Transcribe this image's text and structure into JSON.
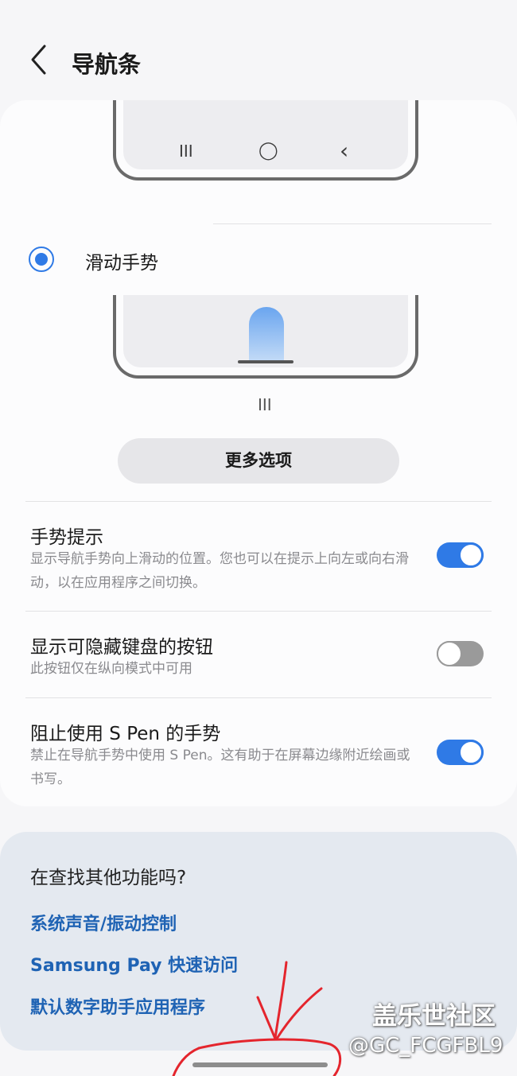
{
  "header": {
    "title": "导航条",
    "back_icon": "chevron-left-icon"
  },
  "preview_buttons": {
    "icons": [
      "recents-icon",
      "home-icon",
      "back-icon"
    ],
    "recents": "III",
    "home": "◯",
    "back": "‹"
  },
  "swipe_option": {
    "label": "滑动手势",
    "selected": true,
    "handle_glyph": "III"
  },
  "more_options_button": "更多选项",
  "settings": [
    {
      "title": "手势提示",
      "description": "显示导航手势向上滑动的位置。您也可以在提示上向左或向右滑动，以在应用程序之间切换。",
      "enabled": true
    },
    {
      "title": "显示可隐藏键盘的按钮",
      "description": "此按钮仅在纵向模式中可用",
      "enabled": false
    },
    {
      "title": "阻止使用 S Pen 的手势",
      "description": "禁止在导航手势中使用 S Pen。这有助于在屏幕边缘附近绘画或书写。",
      "enabled": true
    }
  ],
  "suggestions": {
    "heading": "在查找其他功能吗?",
    "links": [
      "系统声音/振动控制",
      "Samsung Pay 快速访问",
      "默认数字助手应用程序"
    ]
  },
  "watermark": {
    "line1": "盖乐世社区",
    "line2": "@GC_FCGFBL9"
  },
  "colors": {
    "accent": "#2f7ae6",
    "link": "#1f63b4",
    "annotation": "#e4252d",
    "toggle_off": "#9a9a9a"
  }
}
